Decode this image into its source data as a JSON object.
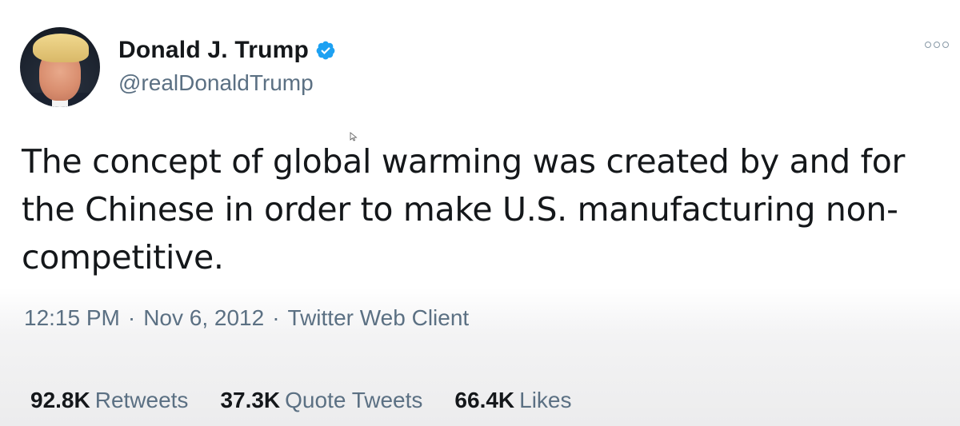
{
  "author": {
    "display_name": "Donald J. Trump",
    "handle": "@realDonaldTrump",
    "verified": true,
    "avatar_icon": "profile-photo"
  },
  "tweet": {
    "text": "The concept of global warming was created by and for the Chinese in order to make U.S. manufacturing non-competitive."
  },
  "meta": {
    "time": "12:15 PM",
    "separator": "·",
    "date": "Nov 6, 2012",
    "source": "Twitter Web Client"
  },
  "stats": [
    {
      "count": "92.8K",
      "label": "Retweets"
    },
    {
      "count": "37.3K",
      "label": "Quote Tweets"
    },
    {
      "count": "66.4K",
      "label": "Likes"
    }
  ],
  "colors": {
    "verified_badge": "#1da1f2",
    "secondary_text": "#5b7083",
    "primary_text": "#14171a"
  },
  "icons": {
    "more": "more-options-icon",
    "verified": "verified-badge-icon"
  }
}
